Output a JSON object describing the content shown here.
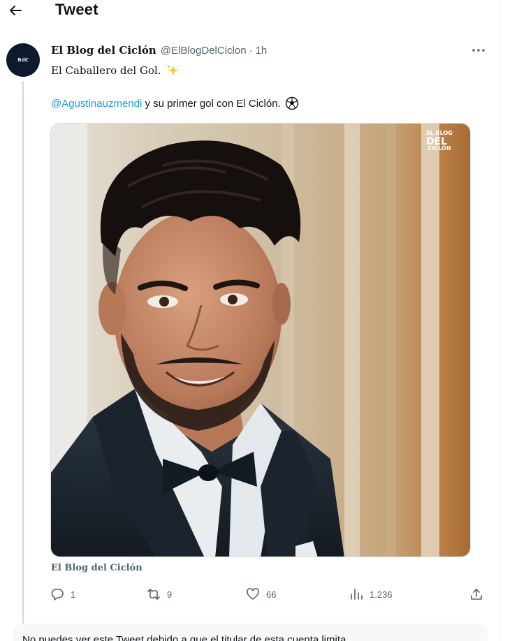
{
  "header": {
    "title": "Tweet",
    "back_icon": "arrow-left-icon"
  },
  "tweet": {
    "avatar_text": "BdC",
    "display_name": "El Blog del Ciclón",
    "handle": "@ElBlogDelCiclon",
    "separator": "·",
    "time": "1h",
    "more_icon": "more-horizontal-icon",
    "line1": "El Caballero del Gol.",
    "line1_emoji": "sparkles-icon",
    "mention": "@Agustinauzmendi",
    "line2_rest": " y su primer gol con El Ciclón.",
    "line2_emoji": "soccer-ball-icon",
    "media_watermark": [
      "EL BLOG",
      "DEL",
      "CICLÓN"
    ],
    "media_source": "El Blog del Ciclón",
    "stats": {
      "replies": "1",
      "retweets": "9",
      "likes": "66",
      "views": "1.236"
    },
    "icons": [
      "reply-icon",
      "retweet-icon",
      "like-icon",
      "views-icon",
      "share-icon"
    ]
  },
  "notice": {
    "text": "No puedes ver este Tweet debido a que el titular de esta cuenta limita"
  },
  "colors": {
    "accent": "#1d9bf0",
    "secondary_text": "#536471",
    "border": "#eff3f4"
  }
}
